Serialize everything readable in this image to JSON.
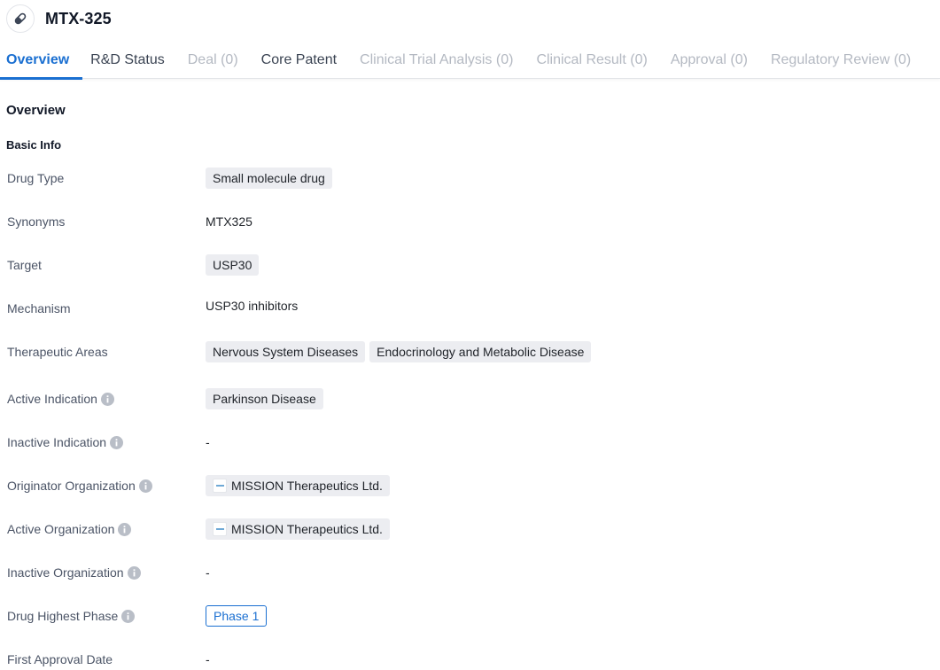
{
  "header": {
    "icon": "pill-icon",
    "title": "MTX-325"
  },
  "tabs": [
    {
      "label": "Overview",
      "state": "active"
    },
    {
      "label": "R&D Status",
      "state": "normal"
    },
    {
      "label": "Deal (0)",
      "state": "disabled"
    },
    {
      "label": "Core Patent",
      "state": "normal"
    },
    {
      "label": "Clinical Trial Analysis (0)",
      "state": "disabled"
    },
    {
      "label": "Clinical Result (0)",
      "state": "disabled"
    },
    {
      "label": "Approval (0)",
      "state": "disabled"
    },
    {
      "label": "Regulatory Review (0)",
      "state": "disabled"
    }
  ],
  "section": {
    "title": "Overview",
    "subtitle": "Basic Info"
  },
  "fields": {
    "drug_type": {
      "label": "Drug Type",
      "tags": [
        "Small molecule drug"
      ]
    },
    "synonyms": {
      "label": "Synonyms",
      "value": "MTX325"
    },
    "target": {
      "label": "Target",
      "tags": [
        "USP30"
      ]
    },
    "mechanism": {
      "label": "Mechanism",
      "value": "USP30 inhibitors"
    },
    "therapeutic_areas": {
      "label": "Therapeutic Areas",
      "tags": [
        "Nervous System Diseases",
        "Endocrinology and Metabolic Disease"
      ]
    },
    "active_indication": {
      "label": "Active Indication",
      "info": true,
      "tags": [
        "Parkinson Disease"
      ]
    },
    "inactive_indication": {
      "label": "Inactive Indication",
      "info": true,
      "value": "-"
    },
    "originator_organization": {
      "label": "Originator Organization",
      "info": true,
      "orgs": [
        "MISSION Therapeutics Ltd."
      ]
    },
    "active_organization": {
      "label": "Active Organization",
      "info": true,
      "orgs": [
        "MISSION Therapeutics Ltd."
      ]
    },
    "inactive_organization": {
      "label": "Inactive Organization",
      "info": true,
      "value": "-"
    },
    "drug_highest_phase": {
      "label": "Drug Highest Phase",
      "info": true,
      "phase": "Phase 1"
    },
    "first_approval_date": {
      "label": "First Approval Date",
      "value": "-"
    }
  },
  "colors": {
    "accent": "#1a6fd1",
    "tag_bg": "#ecedf1",
    "label_text": "#4b5466",
    "disabled_tab": "#b4b9c2"
  }
}
